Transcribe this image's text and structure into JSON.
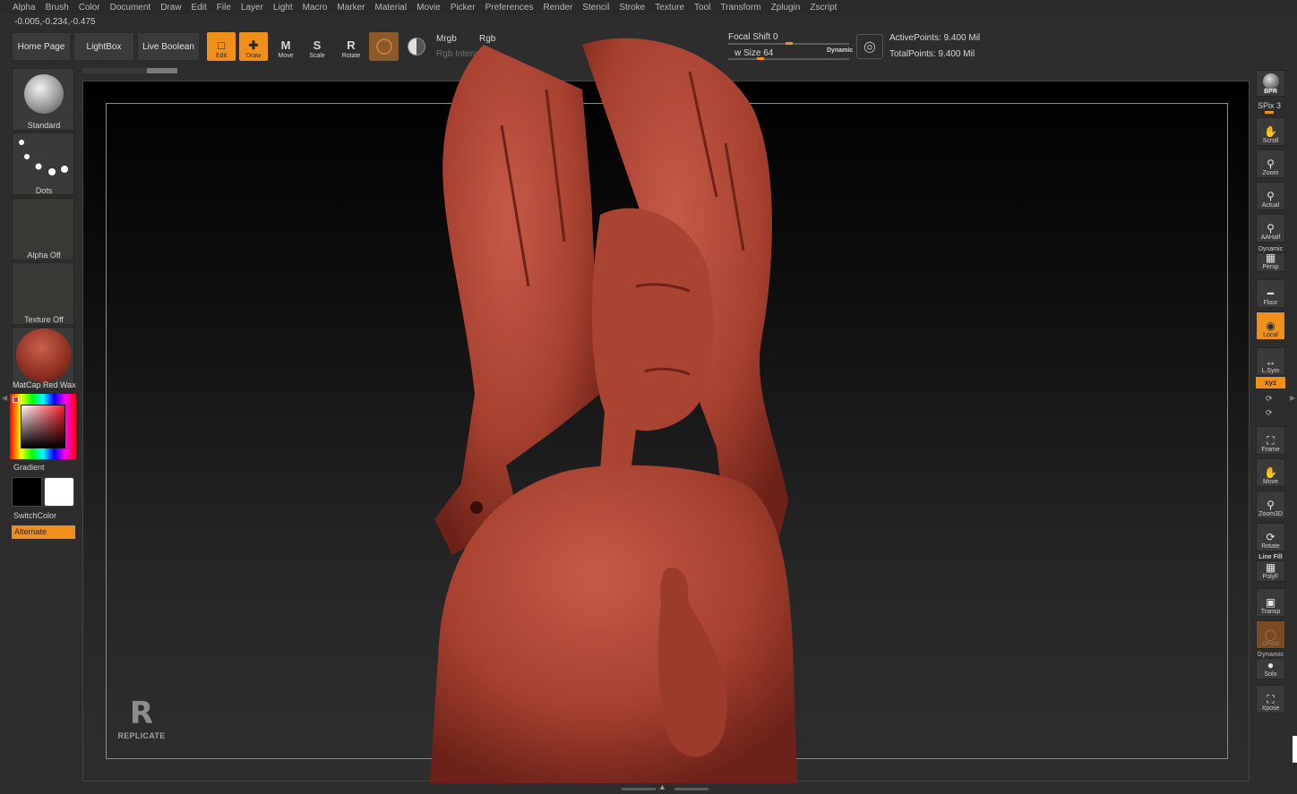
{
  "menu": [
    "Alpha",
    "Brush",
    "Color",
    "Document",
    "Draw",
    "Edit",
    "File",
    "Layer",
    "Light",
    "Macro",
    "Marker",
    "Material",
    "Movie",
    "Picker",
    "Preferences",
    "Render",
    "Stencil",
    "Stroke",
    "Texture",
    "Tool",
    "Transform",
    "Zplugin",
    "Zscript"
  ],
  "coords": "-0.005,-0.234,-0.475",
  "toolbar": {
    "home_page": "Home Page",
    "lightbox": "LightBox",
    "live_boolean": "Live Boolean",
    "edit": "Edit",
    "draw": "Draw",
    "move": "Move",
    "scale": "Scale",
    "rotate": "Rotate",
    "mrgb": "Mrgb",
    "rgb": "Rgb",
    "rgb_intensity": "Rgb Intensity",
    "focal_shift": "Focal Shift 0",
    "draw_size": "w Size 64",
    "dynamic": "Dynamic",
    "active_points": "ActivePoints: 9.400 Mil",
    "total_points": "TotalPoints: 9.400 Mil"
  },
  "left_shelf": {
    "brush": "Standard",
    "stroke": "Dots",
    "alpha": "Alpha Off",
    "texture": "Texture Off",
    "material": "MatCap Red Wax",
    "gradient": "Gradient",
    "switch_color": "SwitchColor",
    "alternate": "Alternate"
  },
  "watermark": "REPLICATE",
  "right_shelf": {
    "bpr": "BPR",
    "spix": "SPix 3",
    "scroll": "Scroll",
    "zoom": "Zoom",
    "actual": "Actual",
    "aahalf": "AAHalf",
    "persp_top": "Dynamic",
    "persp": "Persp",
    "floor": "Floor",
    "local": "Local",
    "lsym": "L.Sym",
    "xyz": "xyz",
    "frame": "Frame",
    "move": "Move",
    "zoom3d": "Zoom3D",
    "rotate": "Rotate",
    "polyf_top": "Line Fill",
    "polyf": "PolyF",
    "transp": "Transp",
    "ghost": "Ghost",
    "solo_top": "Dynamic",
    "solo": "Solo",
    "xpose": "Xpose"
  },
  "colors": {
    "accent": "#f0901a",
    "sculpt": "#b3493a",
    "viewport_top": "#000000",
    "viewport_bottom": "#2e2e2e"
  }
}
